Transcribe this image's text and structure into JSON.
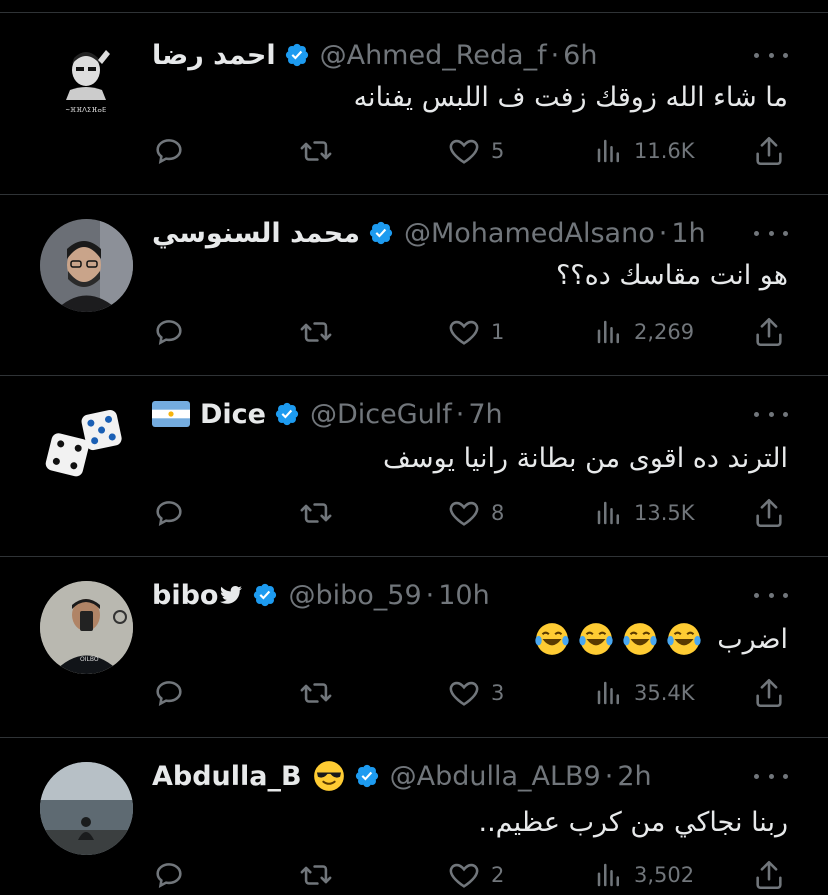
{
  "tweets": [
    {
      "name": "احمد رضا",
      "handle": "@Ahmed_Reda_f",
      "separator": "·",
      "time": "6h",
      "text": "ما شاء الله زوقك زفت ف اللبس يفنانه",
      "replies": "",
      "retweets": "",
      "likes": "5",
      "views": "11.6K",
      "avatar_icon": "sketch-portrait-avatar"
    },
    {
      "name": "محمد السنوسي",
      "handle": "@MohamedAlsano",
      "separator": "·",
      "time": "1h",
      "text": "هو انت مقاسك ده؟؟",
      "replies": "",
      "retweets": "",
      "likes": "1",
      "views": "2,269",
      "avatar_icon": "bearded-man-glasses-avatar"
    },
    {
      "name": "Dice",
      "handle": "@DiceGulf",
      "separator": "·",
      "time": "7h",
      "text": "الترند ده اقوى من بطانة رانيا يوسف",
      "replies": "",
      "retweets": "",
      "likes": "8",
      "views": "13.5K",
      "avatar_icon": "dice-avatar",
      "flag_icon": "argentina-flag-icon"
    },
    {
      "name": "bibo",
      "handle": "@bibo_59",
      "separator": "·",
      "time": "10h",
      "text": "اضرب",
      "replies": "",
      "retweets": "",
      "likes": "3",
      "views": "35.4K",
      "avatar_icon": "mirror-selfie-avatar",
      "name_icon": "bird-icon",
      "text_emoji": "laughing-tears-emoji",
      "text_emoji_count": 4
    },
    {
      "name": "Abdulla_B",
      "handle": "@Abdulla_ALB9",
      "separator": "·",
      "time": "2h",
      "text": "ربنا نجاكي من كرب عظيم..",
      "replies": "",
      "retweets": "",
      "likes": "2",
      "views": "3,502",
      "avatar_icon": "seaside-silhouette-avatar",
      "name_icon": "sunglasses-emoji"
    }
  ],
  "colors": {
    "background": "#000000",
    "text": "#e7e9ea",
    "secondary": "#71767b",
    "divider": "#2f3336",
    "verified": "#1d9bf0"
  }
}
